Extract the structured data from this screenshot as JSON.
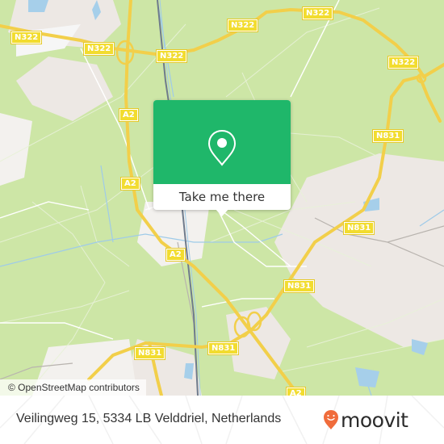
{
  "map": {
    "background_color": "#cde6a6",
    "road_labels": [
      {
        "id": "n322-a",
        "text": "N322"
      },
      {
        "id": "n322-b",
        "text": "N322"
      },
      {
        "id": "n322-c",
        "text": "N322"
      },
      {
        "id": "n322-d",
        "text": "N322"
      },
      {
        "id": "n322-e",
        "text": "N322"
      },
      {
        "id": "a2-a",
        "text": "A2"
      },
      {
        "id": "a2-b",
        "text": "A2"
      },
      {
        "id": "a2-c",
        "text": "A2"
      },
      {
        "id": "a2-d",
        "text": "A2"
      },
      {
        "id": "n831-a",
        "text": "N831"
      },
      {
        "id": "n831-b",
        "text": "N831"
      },
      {
        "id": "n831-c",
        "text": "N831"
      },
      {
        "id": "n831-d",
        "text": "N831"
      },
      {
        "id": "n831-e",
        "text": "N831"
      },
      {
        "id": "n831-f",
        "text": "N831"
      }
    ],
    "attribution": "© OpenStreetMap contributors"
  },
  "popup": {
    "icon": "location-pin-icon",
    "button_label": "Take me there",
    "accent_color": "#1fb76a"
  },
  "footer": {
    "address": "Veilingweg 15, 5334 LB Velddriel, Netherlands",
    "logo_text": "moovit",
    "logo_color": "#f06c3b"
  }
}
